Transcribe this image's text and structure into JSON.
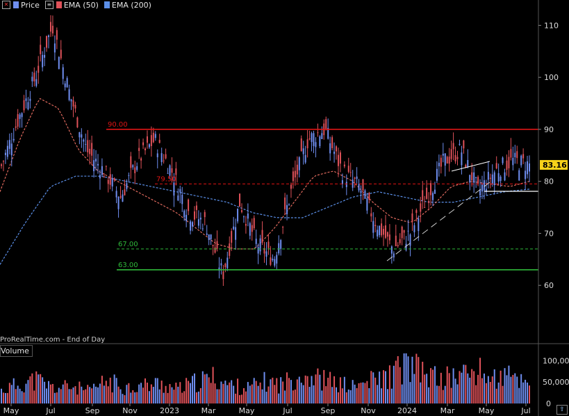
{
  "legend": {
    "price_label": "Price",
    "ema50_label": "EMA (50)",
    "ema200_label": "EMA (200)"
  },
  "credit": "ProRealTime.com - End of Day",
  "volume_label": "Volume",
  "colors": {
    "background": "#000000",
    "bull": "#6f8ef0",
    "bear": "#e0525a",
    "ema50": "#e06a5e",
    "ema200": "#5b8fe8",
    "level_red": "#e01515",
    "level_green": "#2fb83a",
    "last_price_bg": "#f7d21a"
  },
  "chart_data": [
    {
      "type": "line",
      "name": "price-panel",
      "x_ticks": [
        "May",
        "Jul",
        "Sep",
        "Nov",
        "2023",
        "Mar",
        "May",
        "Jul",
        "Sep",
        "Nov",
        "2024",
        "Mar",
        "May",
        "Jul"
      ],
      "ylim": [
        52,
        113
      ],
      "y_ticks": [
        60,
        70,
        80,
        90,
        100,
        110
      ],
      "last_price": "83.16",
      "horizontal_levels": [
        {
          "label": "90.00",
          "value": 90.0,
          "style": "solid",
          "color": "red"
        },
        {
          "label": "79.50",
          "value": 79.5,
          "style": "dashed",
          "color": "red"
        },
        {
          "label": "67.00",
          "value": 67.0,
          "style": "dashed",
          "color": "green"
        },
        {
          "label": "63.00",
          "value": 63.0,
          "style": "solid",
          "color": "green"
        }
      ],
      "series": [
        {
          "name": "Price",
          "values": [
            83,
            92,
            100,
            110,
            97,
            86,
            82,
            77,
            84,
            88,
            82,
            74,
            72,
            62,
            76,
            68,
            65,
            78,
            88,
            90,
            82,
            79,
            72,
            67,
            70,
            77,
            84,
            86,
            78,
            82,
            84,
            83.16
          ]
        },
        {
          "name": "EMA (50)",
          "values": [
            78,
            88,
            96,
            94,
            86,
            82,
            80,
            78,
            76,
            74,
            71,
            68,
            67,
            67,
            71,
            76,
            81,
            82,
            80,
            76,
            73,
            72,
            75,
            79,
            80,
            79.5,
            79,
            80
          ]
        },
        {
          "name": "EMA (200)",
          "values": [
            64,
            72,
            79,
            81,
            81,
            80,
            79,
            78,
            77,
            76,
            74,
            73,
            73,
            75,
            77,
            78,
            77,
            76,
            76,
            77,
            78,
            78.5
          ]
        }
      ]
    },
    {
      "type": "bar",
      "name": "volume-panel",
      "ylim": [
        0,
        130000
      ],
      "y_ticks": [
        "0",
        "50,000",
        "100,000"
      ],
      "series": [
        {
          "name": "Volume",
          "values": [
            30000,
            45000,
            55000,
            35000,
            40000,
            28000,
            52000,
            38000,
            41000,
            46000,
            33000,
            48000,
            60000,
            42000,
            36000,
            50000,
            45000,
            70000,
            58000,
            47000,
            38000,
            52000,
            62000,
            90000,
            70000,
            55000,
            66000,
            75000,
            58000,
            62000,
            48000
          ]
        }
      ]
    }
  ]
}
